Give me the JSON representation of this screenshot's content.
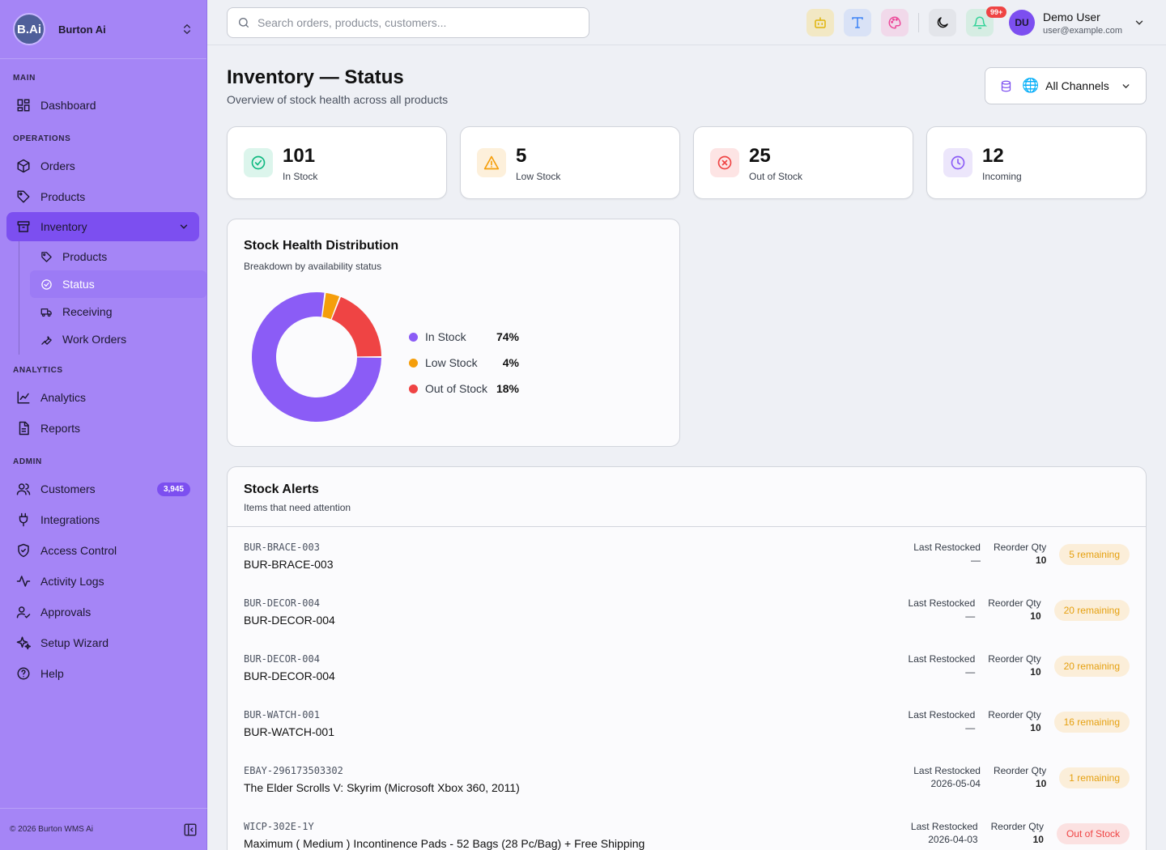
{
  "brand": {
    "logo": "B.Ai",
    "name": "Burton Ai"
  },
  "sidebar": {
    "sections": {
      "main": "MAIN",
      "operations": "OPERATIONS",
      "analytics": "ANALYTICS",
      "admin": "ADMIN"
    },
    "items": {
      "dashboard": "Dashboard",
      "orders": "Orders",
      "products": "Products",
      "inventory": "Inventory",
      "analytics": "Analytics",
      "reports": "Reports",
      "customers": "Customers",
      "customers_count": "3,945",
      "integrations": "Integrations",
      "access_control": "Access Control",
      "activity_logs": "Activity Logs",
      "approvals": "Approvals",
      "setup_wizard": "Setup Wizard",
      "help": "Help"
    },
    "inventory_sub": {
      "products": "Products",
      "status": "Status",
      "receiving": "Receiving",
      "work_orders": "Work Orders"
    },
    "footer": "© 2026 Burton WMS Ai"
  },
  "topbar": {
    "search_placeholder": "Search orders, products, customers...",
    "notifications_badge": "99+",
    "user": {
      "initials": "DU",
      "name": "Demo User",
      "email": "user@example.com"
    }
  },
  "header": {
    "title": "Inventory — Status",
    "subtitle": "Overview of stock health across all products",
    "channel": "All Channels"
  },
  "stats": [
    {
      "value": "101",
      "label": "In Stock",
      "color": "#10b981",
      "bg": "#dcf5ec",
      "icon": "check-circle-icon"
    },
    {
      "value": "5",
      "label": "Low Stock",
      "color": "#f59e0b",
      "bg": "#fdf0db",
      "icon": "warning-triangle-icon"
    },
    {
      "value": "25",
      "label": "Out of Stock",
      "color": "#ef4444",
      "bg": "#fde4e4",
      "icon": "x-circle-icon"
    },
    {
      "value": "12",
      "label": "Incoming",
      "color": "#8b5cf6",
      "bg": "#ece6fb",
      "icon": "clock-icon"
    }
  ],
  "distribution": {
    "title": "Stock Health Distribution",
    "subtitle": "Breakdown by availability status",
    "segments": [
      {
        "label": "In Stock",
        "pct": "74%",
        "value": 101,
        "color": "#8b5cf6"
      },
      {
        "label": "Low Stock",
        "pct": "4%",
        "value": 5,
        "color": "#f59e0b"
      },
      {
        "label": "Out of Stock",
        "pct": "18%",
        "value": 25,
        "color": "#ef4444"
      }
    ]
  },
  "alerts": {
    "title": "Stock Alerts",
    "subtitle": "Items that need attention",
    "col_last_restocked": "Last Restocked",
    "col_reorder_qty": "Reorder Qty",
    "rows": [
      {
        "sku": "BUR-BRACE-003",
        "name": "BUR-BRACE-003",
        "last_restocked": "—",
        "reorder_qty": "10",
        "status": "5 remaining",
        "tone": "warn"
      },
      {
        "sku": "BUR-DECOR-004",
        "name": "BUR-DECOR-004",
        "last_restocked": "—",
        "reorder_qty": "10",
        "status": "20 remaining",
        "tone": "warn"
      },
      {
        "sku": "BUR-DECOR-004",
        "name": "BUR-DECOR-004",
        "last_restocked": "—",
        "reorder_qty": "10",
        "status": "20 remaining",
        "tone": "warn"
      },
      {
        "sku": "BUR-WATCH-001",
        "name": "BUR-WATCH-001",
        "last_restocked": "—",
        "reorder_qty": "10",
        "status": "16 remaining",
        "tone": "warn"
      },
      {
        "sku": "EBAY-296173503302",
        "name": "The Elder Scrolls V: Skyrim (Microsoft Xbox 360, 2011)",
        "last_restocked": "2026-05-04",
        "reorder_qty": "10",
        "status": "1 remaining",
        "tone": "warn"
      },
      {
        "sku": "WICP-302E-1Y",
        "name": "Maximum ( Medium ) Incontinence Pads - 52 Bags (28 Pc/Bag) + Free Shipping",
        "last_restocked": "2026-04-03",
        "reorder_qty": "10",
        "status": "Out of Stock",
        "tone": "danger"
      }
    ]
  }
}
